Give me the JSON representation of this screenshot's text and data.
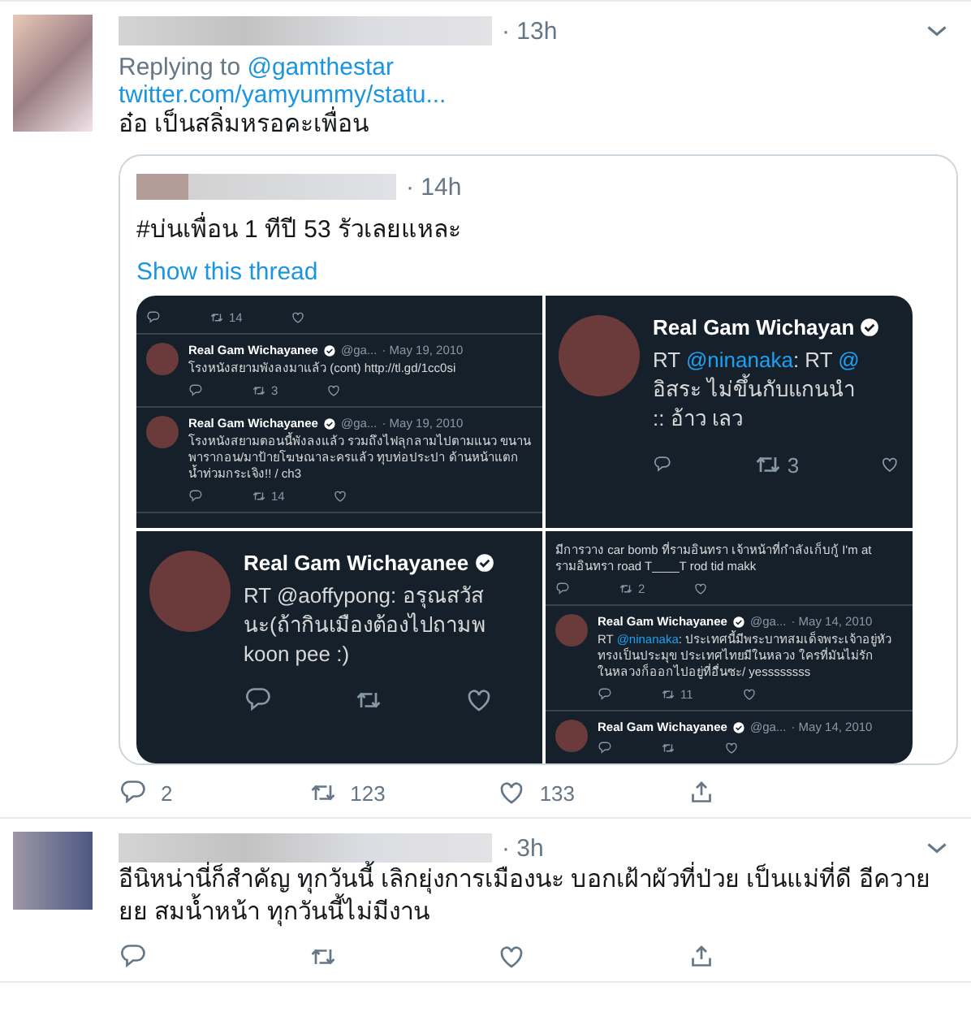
{
  "tweets": [
    {
      "time": "· 13h",
      "replying_label": "Replying to",
      "replying_to": "@gamthestar",
      "link": "twitter.com/yamyummy/statu...",
      "text": "อ๋อ เป็นสลิ่มหรอคะเพื่อน",
      "quote": {
        "time": "· 14h",
        "text": "#บ่นเพื่อน 1 ทีปี 53 รัวเลยแหละ",
        "show_thread": "Show this thread",
        "media": [
          {
            "kind": "small",
            "tweets": [
              {
                "kind": "fragment",
                "retweets": "14"
              },
              {
                "kind": "full",
                "name": "Real Gam Wichayanee",
                "handle": "@ga...",
                "date": "· May 19, 2010",
                "parts": [
                  {
                    "kind": "plain",
                    "text": "โรงหนังสยามพังลงมาแล้ว (cont) http://tl.gd/1cc0si"
                  }
                ],
                "retweets": "3"
              },
              {
                "kind": "full",
                "name": "Real Gam Wichayanee",
                "handle": "@ga...",
                "date": "· May 19, 2010",
                "parts": [
                  {
                    "kind": "plain",
                    "text": "โรงหนังสยามตอนนี้พังลงแล้ว รวมถึงไฟลุกลามไปตามแนว ขนานพารากอน/มาป้ายโฆษณาละครแล้ว ทุบท่อประปา ด้านหน้าแตกน้ำท่วมกระเจิง!! / ch3"
                  }
                ],
                "retweets": "14"
              }
            ]
          },
          {
            "kind": "large",
            "tweets": [
              {
                "kind": "full",
                "name": "Real Gam Wichayan",
                "lines": [
                  [
                    {
                      "kind": "plain",
                      "text": "RT "
                    },
                    {
                      "kind": "mention",
                      "text": "@ninanaka"
                    },
                    {
                      "kind": "plain",
                      "text": ": RT "
                    },
                    {
                      "kind": "mention",
                      "text": "@"
                    }
                  ],
                  [
                    {
                      "kind": "plain",
                      "text": "อิสระ ไม่ขึ้นกับแกนนำ"
                    }
                  ],
                  [
                    {
                      "kind": "plain",
                      "text": ":: อ้าว เลว"
                    }
                  ]
                ],
                "retweets": "3"
              }
            ]
          },
          {
            "kind": "large",
            "tweets": [
              {
                "kind": "full",
                "name": "Real Gam Wichayanee",
                "lines": [
                  [
                    {
                      "kind": "plain",
                      "text": "RT @aoffypong: อรุณสวัส"
                    }
                  ],
                  [
                    {
                      "kind": "plain",
                      "text": "นะ(ถ้ากินเมืองต้องไปถามพ"
                    }
                  ],
                  [
                    {
                      "kind": "plain",
                      "text": "koon pee :)"
                    }
                  ]
                ]
              }
            ]
          },
          {
            "kind": "small",
            "tweets": [
              {
                "kind": "fragment",
                "parts": [
                  {
                    "kind": "plain",
                    "text": "มีการวาง car bomb ที่รามอินทรา เจ้าหน้าที่กำลังเก็บกู้ I'm at รามอินทรา road T____T rod tid makk"
                  }
                ],
                "retweets": "2"
              },
              {
                "kind": "full",
                "name": "Real Gam Wichayanee",
                "handle": "@ga...",
                "date": "· May 14, 2010",
                "parts": [
                  {
                    "kind": "plain",
                    "text": "RT "
                  },
                  {
                    "kind": "mention",
                    "text": "@ninanaka"
                  },
                  {
                    "kind": "plain",
                    "text": ": ประเทศนี้มีพระบาทสมเด็จพระเจ้าอยู่หัว ทรงเป็นประมุข ประเทศไทยมีในหลวง ใครที่มันไม่รัก ในหลวงก็ออกไปอยู่ที่อื่นซะ/ yessssssss"
                  }
                ],
                "retweets": "11"
              },
              {
                "kind": "full",
                "name": "Real Gam Wichayanee",
                "handle": "@ga...",
                "date": "· May 14, 2010"
              }
            ]
          }
        ]
      },
      "replies": "2",
      "retweets": "123",
      "likes": "133"
    },
    {
      "time": "· 3h",
      "text": "อีนิหน่านี่ก็สำคัญ ทุกวันนี้ เลิกยุ่งการเมืองนะ บอกเฝ้าผัวที่ป่วย เป็นแม่ที่ดี อีควายยย สมน้ำหน้า ทุกวันนี้ไม่มีงาน"
    }
  ]
}
